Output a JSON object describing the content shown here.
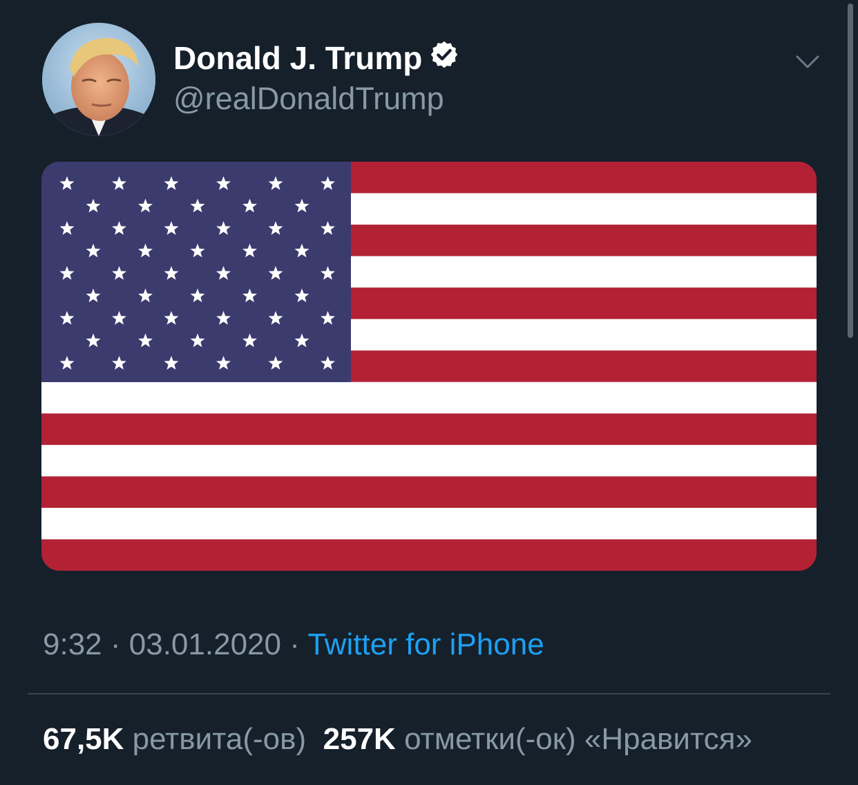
{
  "author": {
    "display_name": "Donald J. Trump",
    "handle": "@realDonaldTrump",
    "verified": true,
    "avatar_icon": "user-avatar-photo"
  },
  "media": {
    "type": "image",
    "subject": "flag-of-united-states"
  },
  "meta": {
    "time": "9:32",
    "separator": "·",
    "date": "03.01.2020",
    "source": "Twitter for iPhone"
  },
  "stats": {
    "retweets_count": "67,5K",
    "retweets_label": "ретвита(-ов)",
    "likes_count": "257K",
    "likes_label": "отметки(-ок) «Нравится»"
  },
  "colors": {
    "background": "#15202b",
    "secondary_text": "#8899a6",
    "link": "#1da1f2",
    "divider": "#38444d",
    "flag_red": "#b22234",
    "flag_blue": "#3c3b6e"
  }
}
